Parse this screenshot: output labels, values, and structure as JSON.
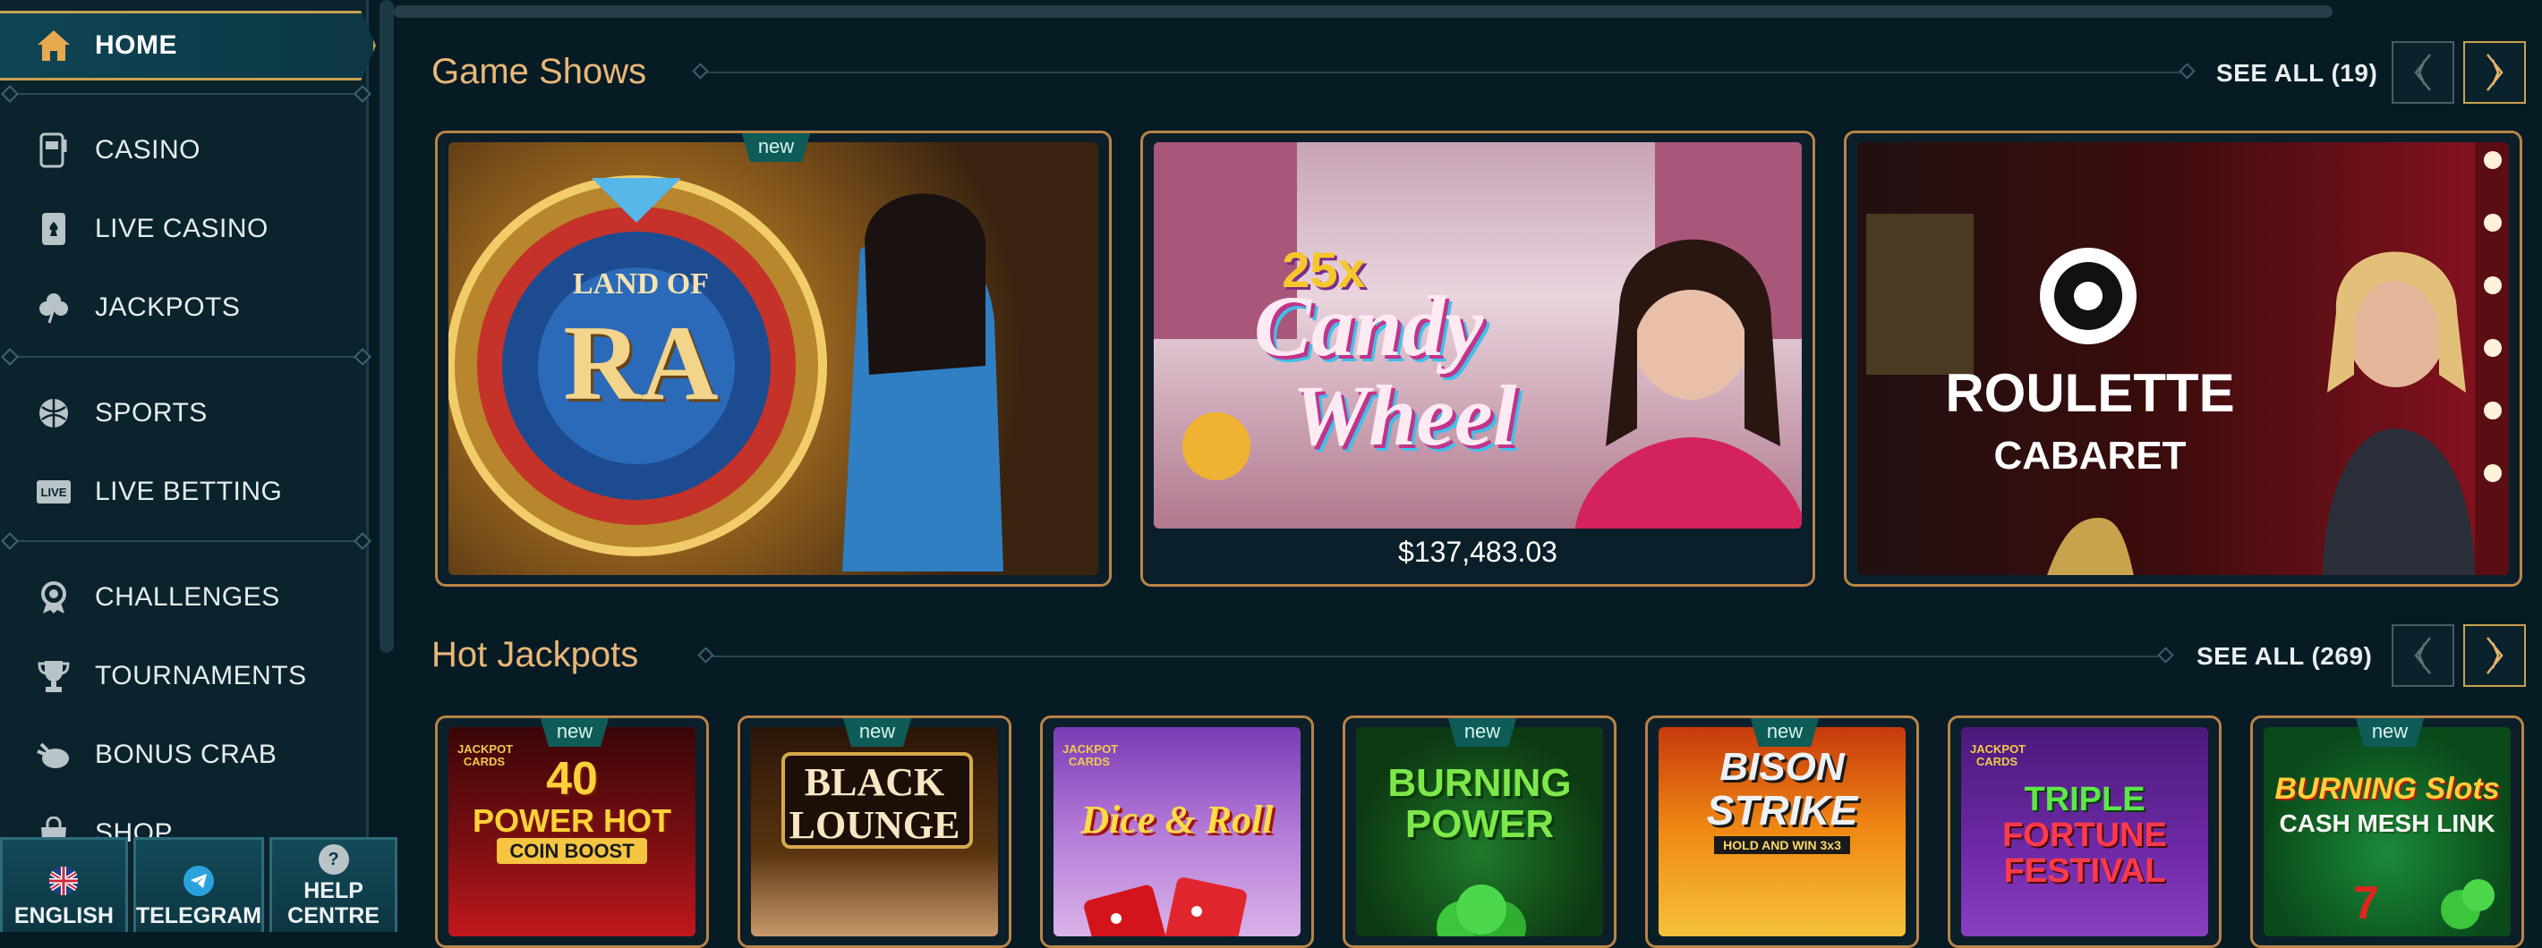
{
  "sidebar": {
    "home": "HOME",
    "items": [
      "CASINO",
      "LIVE CASINO",
      "JACKPOTS",
      "SPORTS",
      "LIVE BETTING",
      "CHALLENGES",
      "TOURNAMENTS",
      "BONUS CRAB",
      "SHOP"
    ],
    "bottom": {
      "english": "ENGLISH",
      "telegram": "TELEGRAM",
      "help": "HELP CENTRE"
    },
    "icons": [
      "home-icon",
      "slot-machine-icon",
      "playing-card-icon",
      "clover-icon",
      "ball-icon",
      "live-icon",
      "badge-icon",
      "trophy-icon",
      "crab-icon",
      "shop-icon"
    ]
  },
  "sections": {
    "game_shows": {
      "title": "Game Shows",
      "see_all": "SEE ALL (19)"
    },
    "hot_jackpots": {
      "title": "Hot Jackpots",
      "see_all": "SEE ALL (269)"
    }
  },
  "game_shows": [
    {
      "title_line1": "LAND OF",
      "title_line2": "RA",
      "badge": "new"
    },
    {
      "title_line1": "25x",
      "title_line2": "Candy",
      "title_line3": "Wheel",
      "prize": "$137,483.03"
    },
    {
      "title_line1": "ROULETTE",
      "title_line2": "CABARET"
    }
  ],
  "jackpots": [
    {
      "brand": "JACKPOT CARDS",
      "line1": "40",
      "line2": "POWER HOT",
      "line3": "COIN BOOST",
      "badge": "new"
    },
    {
      "line1": "BLACK",
      "line2": "LOUNGE",
      "badge": "new"
    },
    {
      "brand": "JACKPOT CARDS",
      "line1": "Dice & Roll"
    },
    {
      "line1": "BURNING",
      "line2": "POWER",
      "badge": "new"
    },
    {
      "line1": "BISON",
      "line2": "STRIKE",
      "line3": "HOLD AND WIN 3x3",
      "badge": "new"
    },
    {
      "brand": "JACKPOT CARDS",
      "line1": "TRIPLE",
      "line2": "FORTUNE",
      "line3": "FESTIVAL"
    },
    {
      "line1": "BURNING Slots",
      "line2": "CASH MESH LINK",
      "badge": "new"
    }
  ],
  "colors": {
    "accent": "#c9a24e",
    "section_title": "#e9b778",
    "background": "#061b24",
    "badge": "#0e5b57"
  }
}
